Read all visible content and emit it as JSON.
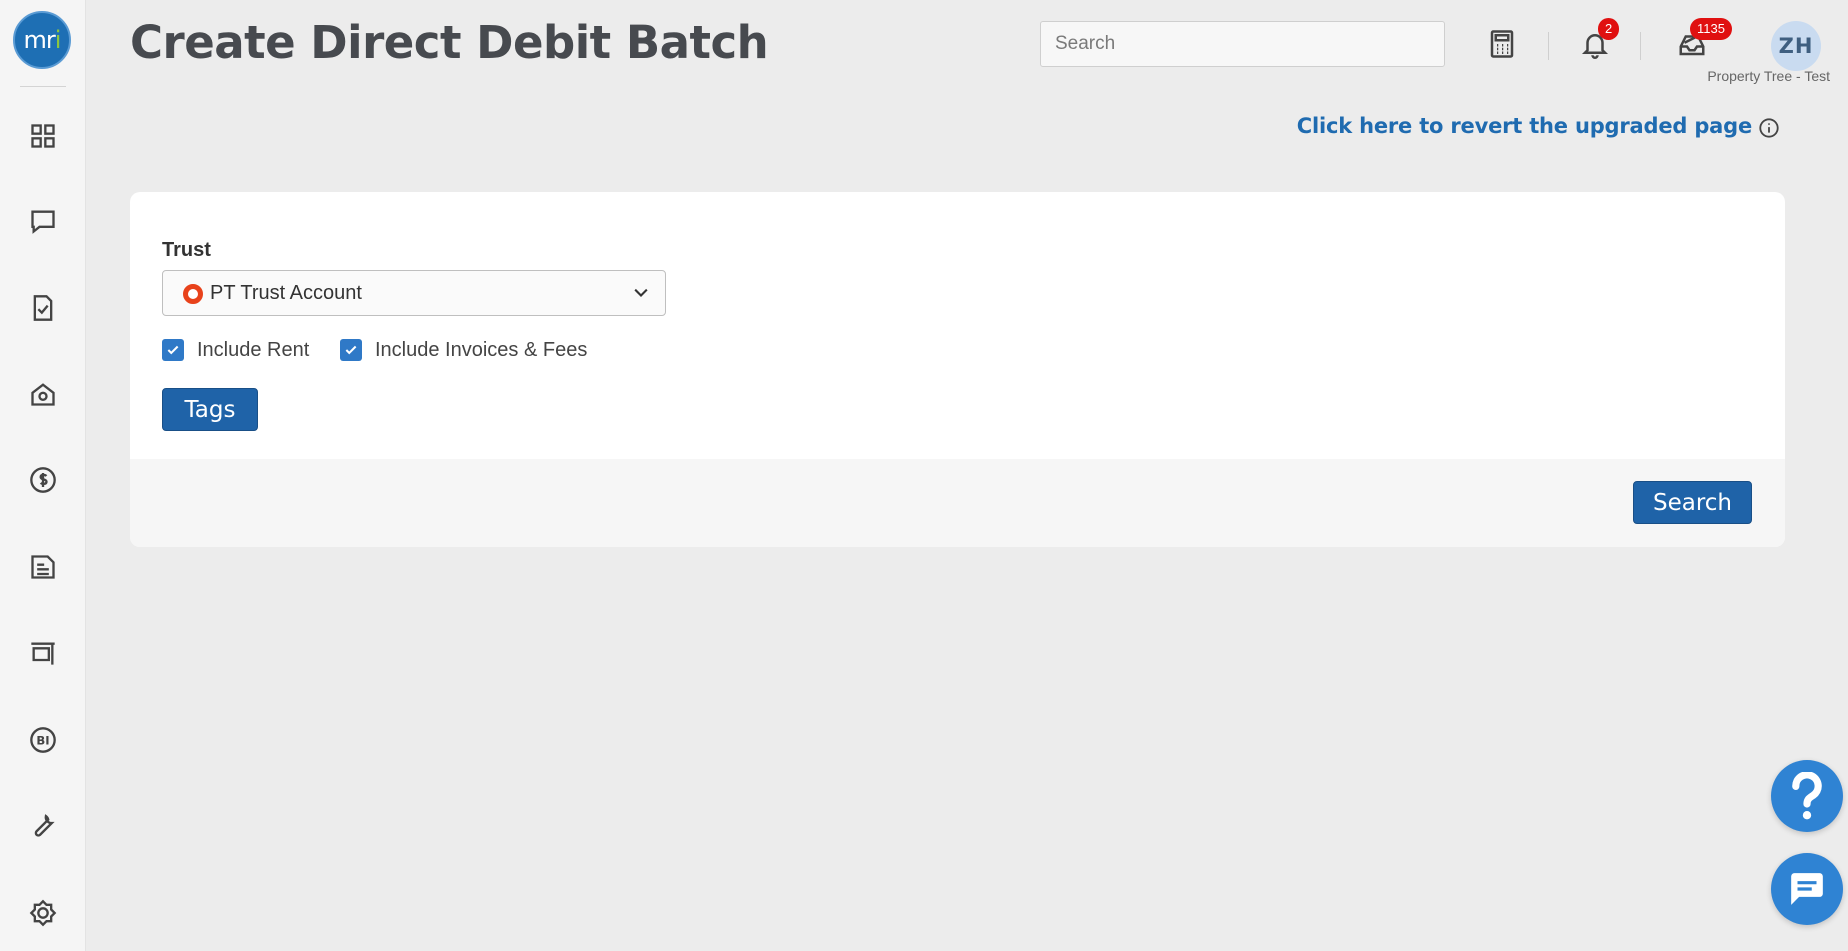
{
  "logo": {
    "text_main": "mr",
    "text_accent": "i"
  },
  "sidebar": {
    "items": [
      {
        "icon": "dashboard-grid-icon"
      },
      {
        "icon": "chat-bubble-icon"
      },
      {
        "icon": "document-check-icon"
      },
      {
        "icon": "property-home-icon"
      },
      {
        "icon": "dollar-circle-icon"
      },
      {
        "icon": "newspaper-icon"
      },
      {
        "icon": "frame-icon"
      },
      {
        "icon": "bi-circle-icon"
      },
      {
        "icon": "wrench-icon"
      },
      {
        "icon": "gear-icon"
      }
    ]
  },
  "header": {
    "title": "Create Direct Debit Batch",
    "search_placeholder": "Search",
    "notifications_count": "2",
    "tasks_count": "1135",
    "avatar_initials": "ZH",
    "org_name": "Property Tree - Test"
  },
  "revert_link": "Click here to revert the upgraded page",
  "form": {
    "trust_label": "Trust",
    "trust_value": "PT Trust Account",
    "include_rent_label": "Include Rent",
    "include_rent_checked": true,
    "include_invoices_label": "Include Invoices & Fees",
    "include_invoices_checked": true,
    "tags_button": "Tags",
    "search_button": "Search"
  },
  "colors": {
    "primary": "#1f63a8",
    "link": "#1f6bb0",
    "badge": "#e01010",
    "trust_dot": "#e8421b",
    "fab": "#2f83d3"
  },
  "fabs": {
    "help_icon": "question-mark-icon",
    "chat_icon": "chat-icon"
  }
}
